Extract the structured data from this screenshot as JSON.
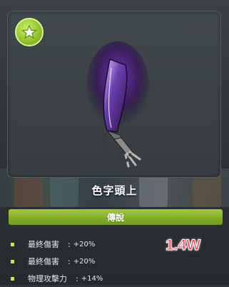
{
  "item": {
    "name": "色字頭上",
    "rank": "傳說"
  },
  "badge_icon": "star-icon",
  "stats": [
    {
      "label": "最終傷害",
      "value": "+20%"
    },
    {
      "label": "最終傷害",
      "value": "+20%"
    },
    {
      "label": "物理攻擊力",
      "value": "+14%"
    }
  ],
  "separator": ":",
  "overlay_score": "1.4W",
  "colors": {
    "rank_bar": "#84ad2a",
    "score": "#ff3c52",
    "bullet": "#d8e24a",
    "weapon_glow": "#6a2fb5"
  }
}
